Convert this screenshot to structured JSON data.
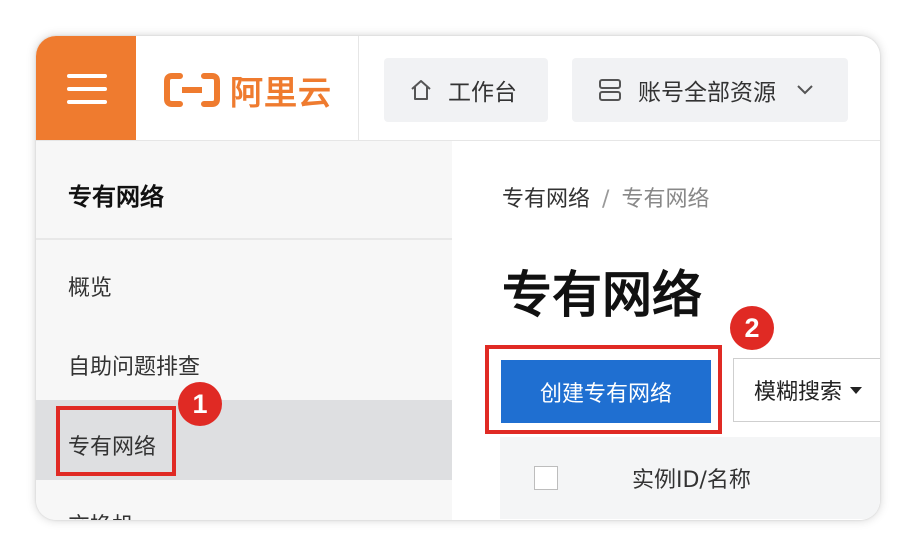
{
  "header": {
    "brand_name": "阿里云",
    "workbench_label": "工作台",
    "resources_label": "账号全部资源",
    "brand_color": "#ef7b2f"
  },
  "sidebar": {
    "title": "专有网络",
    "items": [
      {
        "label": "概览"
      },
      {
        "label": "自助问题排查"
      },
      {
        "label": "专有网络",
        "active": true
      },
      {
        "label": "交换机"
      }
    ]
  },
  "main": {
    "breadcrumb": [
      "专有网络",
      "/",
      "专有网络"
    ],
    "page_title": "专有网络",
    "create_button_label": "创建专有网络",
    "fuzzy_search_label": "模糊搜索",
    "table": {
      "columns": [
        "实例ID/名称"
      ]
    }
  },
  "annotations": {
    "step1": "1",
    "step2": "2",
    "color": "#e02a24"
  }
}
